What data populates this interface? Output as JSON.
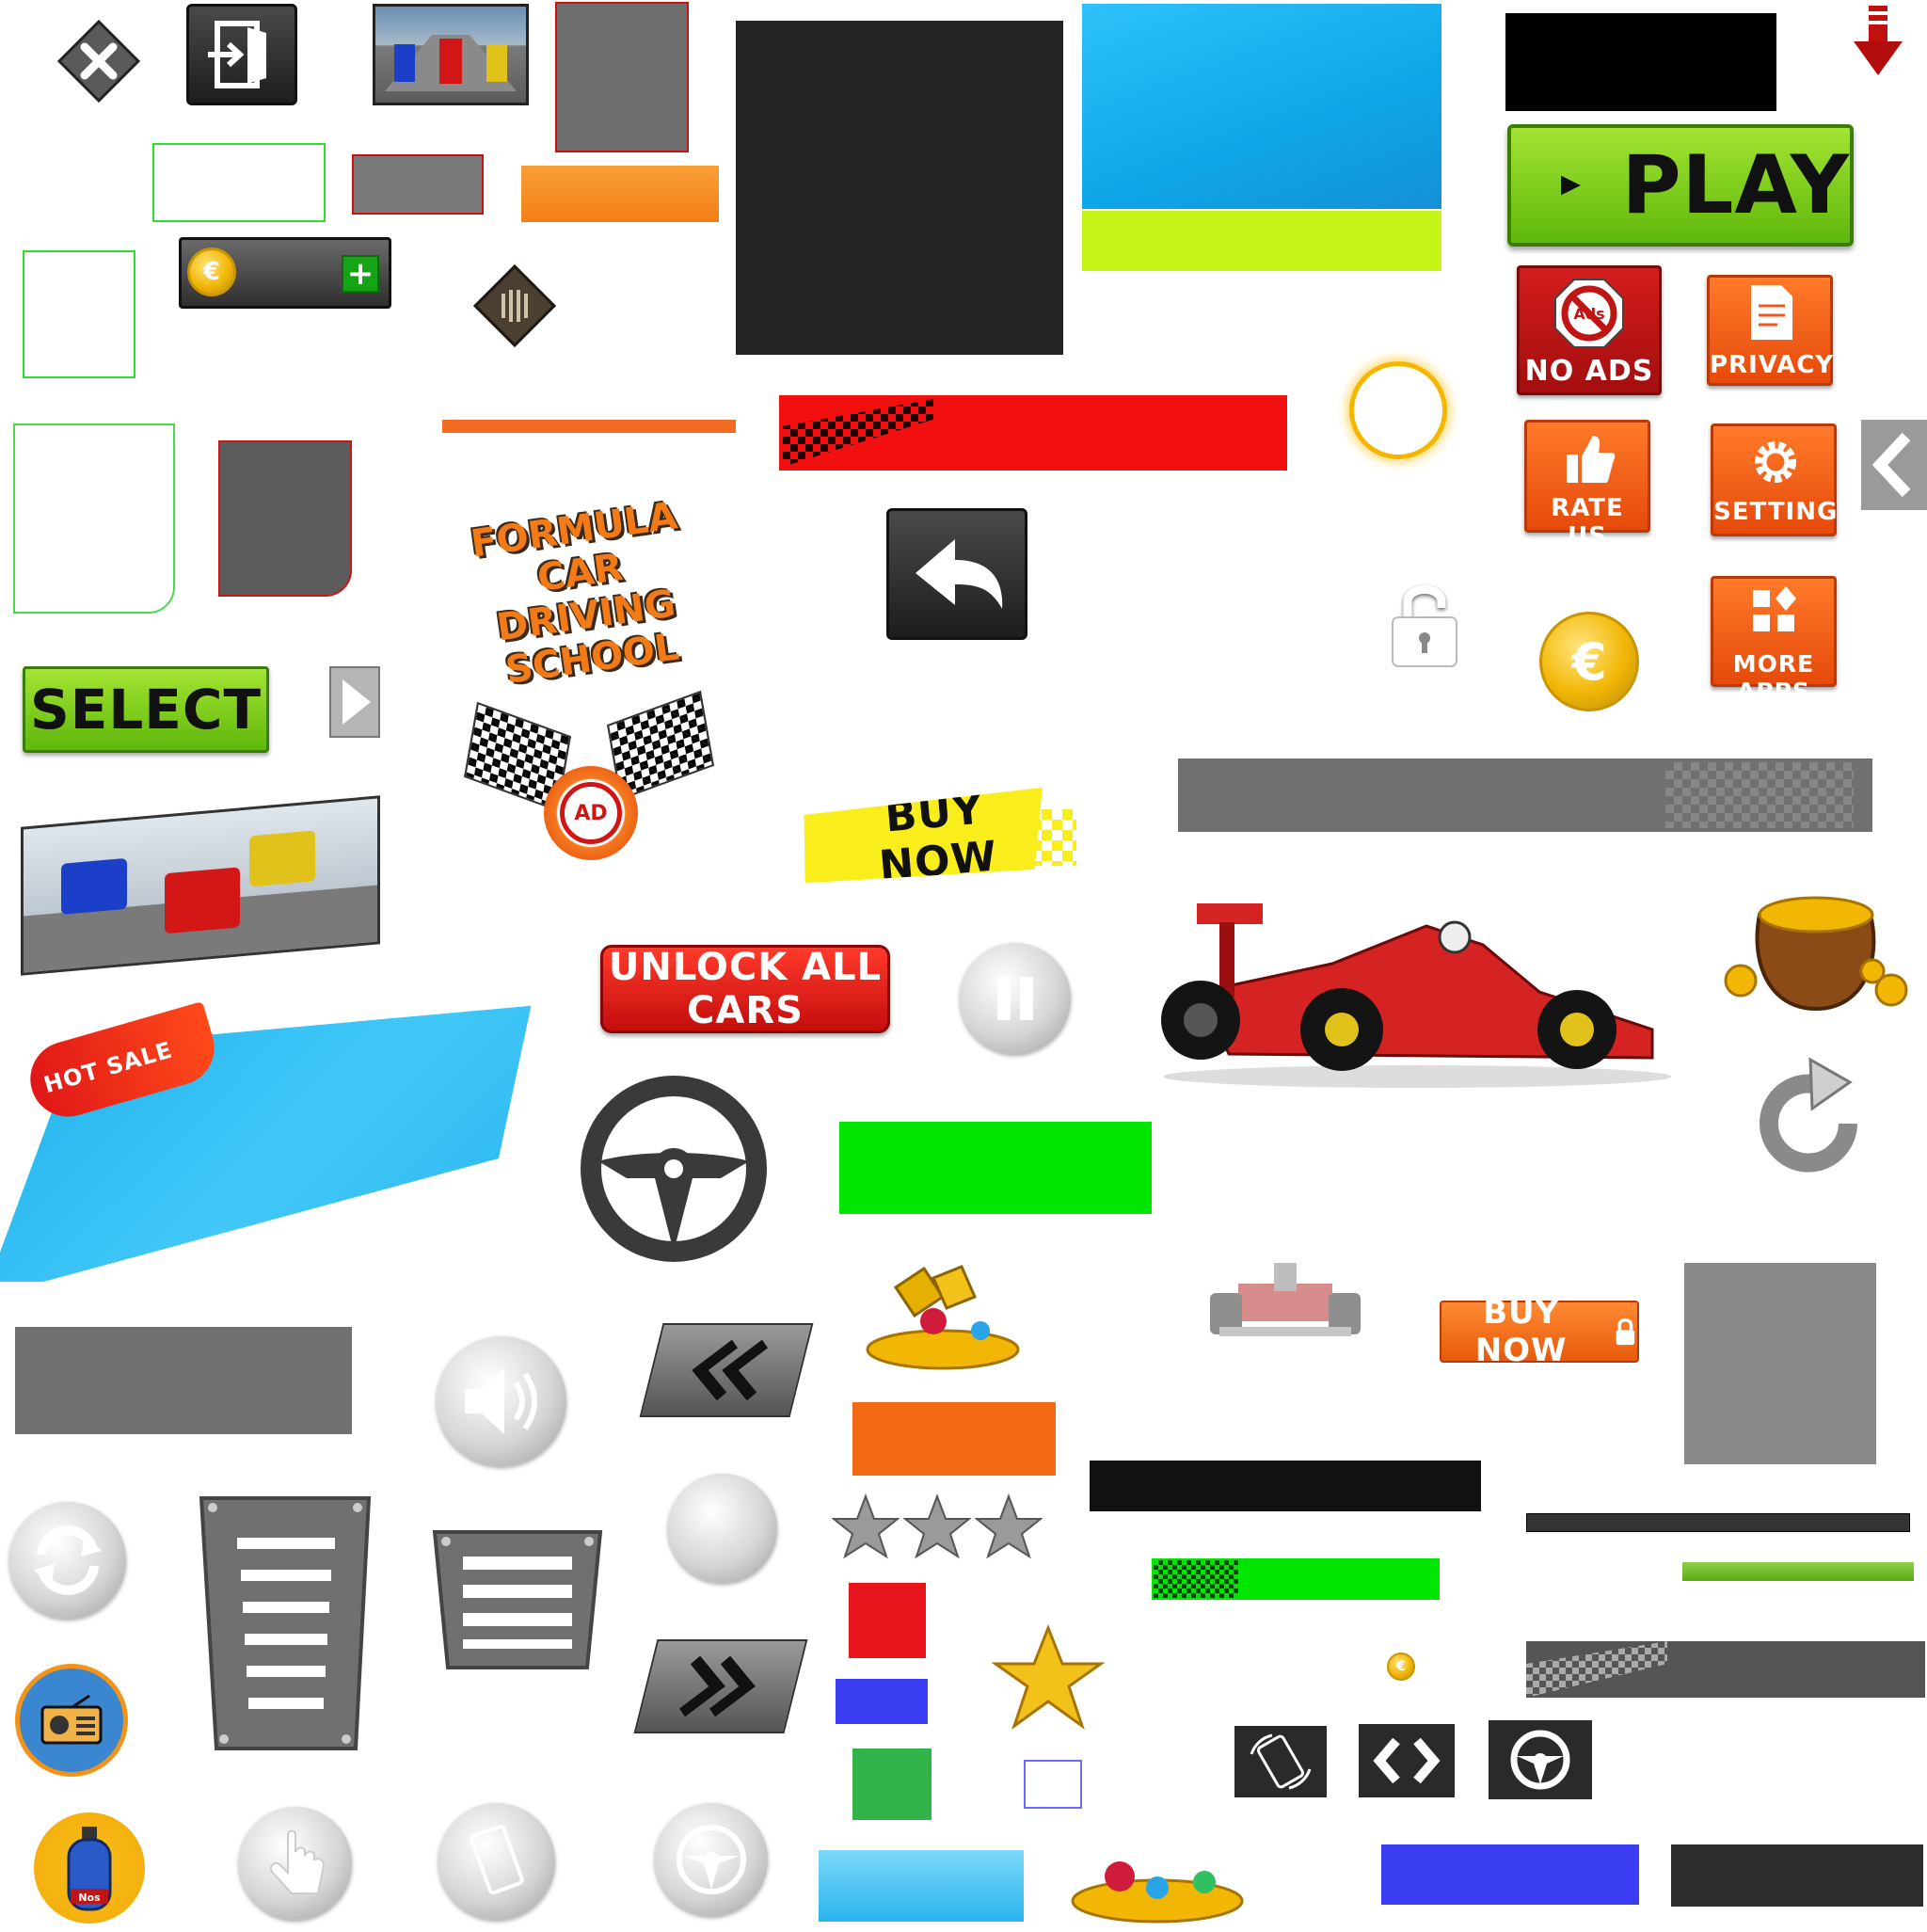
{
  "buttons": {
    "play": "PLAY",
    "select": "SELECT",
    "no_ads": "NO ADS",
    "privacy": "PRIVACY",
    "rate_us": "RATE US",
    "settings": "SETTINGS",
    "more_apps": "MORE APPS",
    "unlock_all_cars": "UNLOCK ALL CARS",
    "buy_now_tag": "BUY NOW",
    "buy_now_locked": "BUY NOW"
  },
  "logo": {
    "line1": "FORMULA CAR",
    "line2": "DRIVING SCHOOL"
  },
  "badges": {
    "hot_sale": "HOT SALE",
    "ad": "AD",
    "ads_sign": "Ads",
    "nos": "Nos"
  },
  "currency_symbol": "€",
  "colors": {
    "play_green": "#7fcc1c",
    "tile_orange": "#f2581b",
    "tile_red": "#c01515",
    "panel_blue": "#14b0f0",
    "lime": "#c6f318",
    "bar_gray": "#707070",
    "bar_red": "#f20f0f",
    "bar_green": "#00e600",
    "dark_panel": "#232323"
  },
  "rating": {
    "stars_filled": 0,
    "stars_total": 3
  }
}
